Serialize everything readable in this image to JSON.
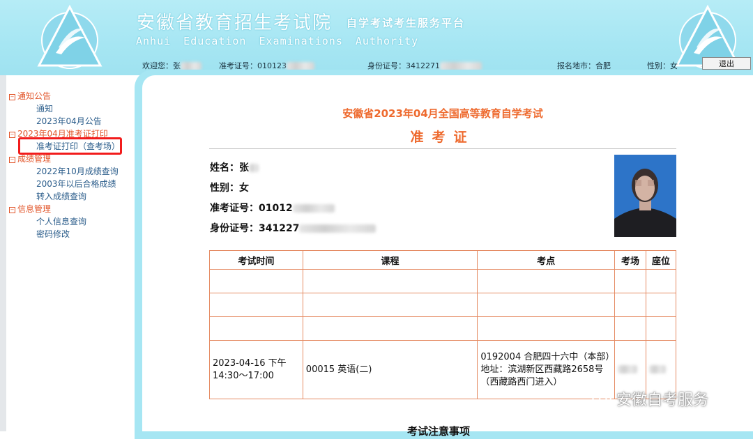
{
  "header": {
    "title": "安徽省教育招生考试院",
    "subtitle": "自学考试考生服务平台",
    "english": "Anhui Education Examinations Authority",
    "welcome_label": "欢迎您：",
    "welcome_value": "张",
    "ticket_label": "准考证号：",
    "ticket_value": "010123",
    "id_label": "身份证号：",
    "id_value": "3412271",
    "region_label": "报名地市：",
    "region_value": "合肥",
    "gender_label": "性别：",
    "gender_value": "女",
    "logout_label": "退出"
  },
  "sidebar": {
    "groups": [
      {
        "label": "通知公告",
        "items": [
          "通知",
          "2023年04月公告"
        ]
      },
      {
        "label": "2023年04月准考证打印",
        "items": [
          "准考证打印（查考场）"
        ]
      },
      {
        "label": "成绩管理",
        "items": [
          "2022年10月成绩查询",
          "2003年以后合格成绩",
          "转入成绩查询"
        ]
      },
      {
        "label": "信息管理",
        "items": [
          "个人信息查询",
          "密码修改"
        ]
      }
    ],
    "expand_marker": "−"
  },
  "card": {
    "exam_title": "安徽省2023年04月全国高等教育自学考试",
    "card_title": "准考证",
    "name": "姓名：张",
    "gender": "性别：女",
    "ticket": "准考证号：01012",
    "id": "身份证号：341227"
  },
  "table": {
    "headers": [
      "考试时间",
      "课程",
      "考点",
      "考场",
      "座位"
    ],
    "row": {
      "time": "2023-04-16 下午 14:30～17:00",
      "course": "00015 英语(二)",
      "site_line1": "0192004 合肥四十六中（本部）",
      "site_line2": "地址：滨湖新区西藏路2658号（西藏路西门进入）"
    }
  },
  "watermark": "安徽自考服务",
  "bottom_heading": "考试注意事项",
  "colors": {
    "accent": "#ee6a2e",
    "header_bg": "#a6e6f3",
    "link": "#2b5d8b",
    "highlight": "#f21c1c"
  }
}
